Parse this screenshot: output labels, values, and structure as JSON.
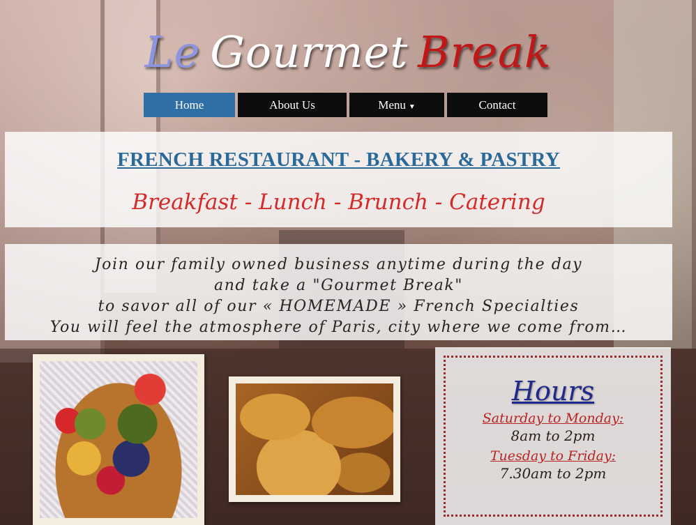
{
  "logo": {
    "word1": "Le",
    "word2": "Gourmet",
    "word3": "Break",
    "colors": {
      "word1": "#8d94e0",
      "word2": "#ffffff",
      "word3": "#c01818"
    }
  },
  "nav": {
    "items": [
      {
        "label": "Home",
        "active": true
      },
      {
        "label": "About Us",
        "active": false
      },
      {
        "label": "Menu",
        "active": false,
        "has_dropdown": true,
        "dropdown_icon": "caret-down-icon"
      },
      {
        "label": "Contact",
        "active": false
      }
    ],
    "active_color": "#2f6fa5"
  },
  "hero": {
    "headline": "FRENCH RESTAURANT - BAKERY & PASTRY",
    "services": "Breakfast - Lunch - Brunch - Catering"
  },
  "intro": {
    "lines": [
      "Join our family owned business anytime during the day",
      "and take a \"Gourmet Break\"",
      "to savor all of our « HOMEMADE » French Specialties",
      "You will feel the atmosphere of Paris, city where we come from…"
    ]
  },
  "photos": {
    "fruit_tart": "fruit-tart-photo",
    "pain_au_chocolat": "pain-au-chocolat-photo"
  },
  "hours": {
    "title": "Hours",
    "schedule": [
      {
        "days": "Saturday to Monday:",
        "time": "8am to 2pm"
      },
      {
        "days": "Tuesday to Friday:",
        "time": "7.30am to 2pm"
      }
    ]
  }
}
